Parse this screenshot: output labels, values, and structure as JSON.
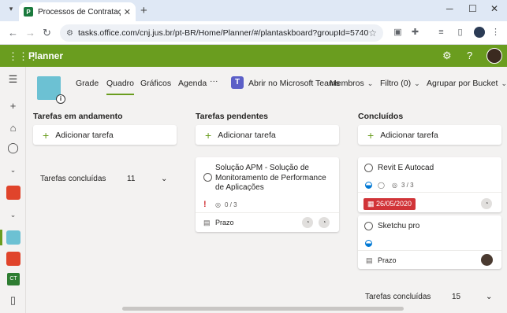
{
  "browser": {
    "tab_title": "Processos de Contratação em",
    "url": "tasks.office.com/cnj.jus.br/pt-BR/Home/Planner/#/plantaskboard?groupId=574015f1-5a60-..."
  },
  "app": {
    "name": "Planner"
  },
  "nav": {
    "tabs": [
      "Grade",
      "Quadro",
      "Gráficos",
      "Agenda"
    ],
    "more": "···",
    "teams": "Abrir no Microsoft Teams",
    "members": "Membros",
    "filter": "Filtro (0)",
    "group_by": "Agrupar por Bucket"
  },
  "rail": {
    "ct_label": "CT"
  },
  "buckets": [
    {
      "title": "Tarefas em andamento",
      "add_label": "Adicionar tarefa",
      "completed_label": "Tarefas concluídas",
      "completed_count": "11"
    },
    {
      "title": "Tarefas pendentes",
      "add_label": "Adicionar tarefa",
      "cards": [
        {
          "title": "Solução APM - Solução de Monitoramento de Performance de Aplicações",
          "priority": "!",
          "checklist": "0 / 3",
          "footer": "Prazo"
        }
      ]
    },
    {
      "title": "Concluídos",
      "add_label": "Adicionar tarefa",
      "cards": [
        {
          "title": "Revit E Autocad",
          "checklist": "3 / 3",
          "due": "26/05/2020"
        },
        {
          "title": "Sketchu pro",
          "footer": "Prazo"
        }
      ],
      "completed_label": "Tarefas concluídas",
      "completed_count": "15"
    }
  ],
  "colors": {
    "brand": "#6a9d1f",
    "due": "#d13438",
    "teams": "#5b5fc7"
  }
}
